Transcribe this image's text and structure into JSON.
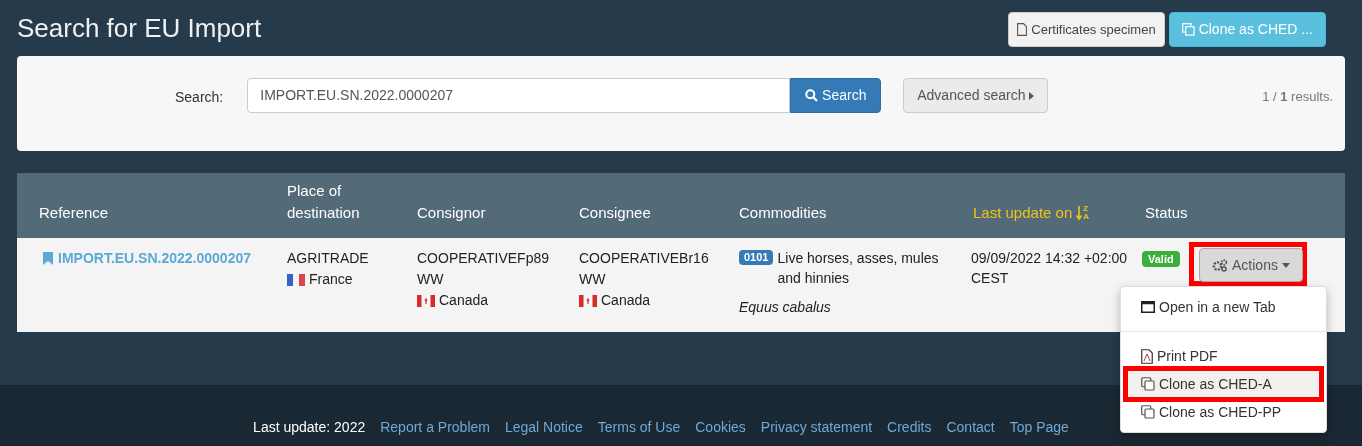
{
  "page_title": "Search for EU Import",
  "header_buttons": [
    {
      "label": "Certificates specimen",
      "kind": "default"
    },
    {
      "label": "Clone as CHED ...",
      "kind": "primary"
    }
  ],
  "search": {
    "label": "Search:",
    "value": "IMPORT.EU.SN.2022.0000207",
    "button": "Search",
    "advanced": "Advanced search",
    "results": "1 / **1** results."
  },
  "table": {
    "columns": [
      {
        "label": "Reference",
        "sorted": false
      },
      {
        "label": "Place of destination",
        "sorted": false
      },
      {
        "label": "Consignor",
        "sorted": false
      },
      {
        "label": "Consignee",
        "sorted": false
      },
      {
        "label": "Commodities",
        "sorted": false
      },
      {
        "label": "Last update on",
        "sorted": true,
        "sort_letters": [
          "Z",
          "A"
        ]
      },
      {
        "label": "Status",
        "sorted": false
      }
    ],
    "rows": [
      {
        "reference": "IMPORT.EU.SN.2022.0000207",
        "destination": {
          "name": "AGRITRADE",
          "country": "France"
        },
        "consignor": {
          "name": "COOPERATIVEFp89 WW",
          "country": "Canada"
        },
        "consignee": {
          "name": "COOPERATIVEBr16 WW",
          "country": "Canada"
        },
        "commodity": {
          "code": "0101",
          "name": "Live horses, asses, mules and hinnies",
          "species": "Equus cabalus"
        },
        "last_update": "09/09/2022 14:32 +02:00 CEST",
        "status": "Valid",
        "actions": {
          "label": "Actions",
          "highlighted": true,
          "open": true,
          "items": [
            {
              "kind": "open_tab",
              "label": "Open in a new Tab",
              "highlighted": false
            },
            {
              "kind": "divider"
            },
            {
              "kind": "print",
              "label": "Print PDF",
              "highlighted": false
            },
            {
              "kind": "clone",
              "label": "Clone as CHED-A",
              "highlighted": true
            },
            {
              "kind": "clone",
              "label": "Clone as CHED-PP",
              "highlighted": false
            }
          ]
        }
      }
    ]
  },
  "footer": {
    "text": "Last update: 2022",
    "links": [
      "Report a Problem",
      "Legal Notice",
      "Terms of Use",
      "Cookies",
      "Privacy statement",
      "Credits",
      "Contact",
      "Top Page"
    ]
  }
}
